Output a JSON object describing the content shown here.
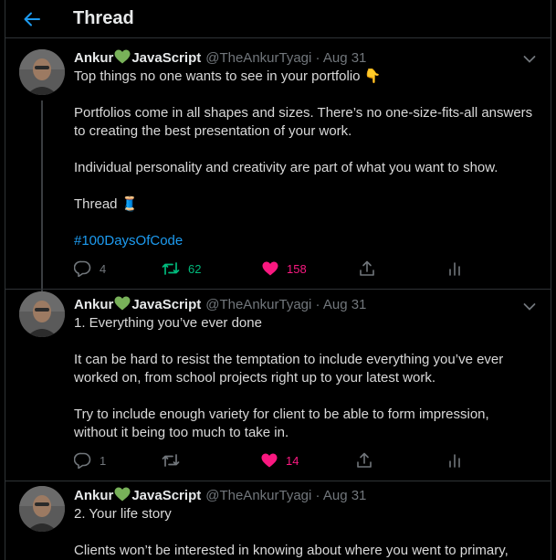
{
  "header": {
    "title": "Thread"
  },
  "tweets": [
    {
      "name_part1": "Ankur",
      "name_part2": "JavaScript",
      "handle": "@TheAnkurTyagi · Aug 31",
      "paragraphs": [
        "Top things no one wants to see in your portfolio 👇",
        "Portfolios come in all shapes and sizes. There’s no one-size-fits-all answers to creating the best presentation of your work.",
        "Individual personality and creativity are part of what you want to show.",
        "Thread 🧵"
      ],
      "hashtag": "#100DaysOfCode",
      "replies": "4",
      "retweets": "62",
      "likes": "158"
    },
    {
      "name_part1": "Ankur",
      "name_part2": "JavaScript",
      "handle": "@TheAnkurTyagi · Aug 31",
      "paragraphs": [
        "1. Everything you’ve ever done",
        "It can be hard to resist the temptation to include everything you’ve ever worked on, from school projects right up to your latest work.",
        "Try to include enough variety for client to be able to form impression, without it being too much to take in."
      ],
      "replies": "1",
      "likes": "14"
    },
    {
      "name_part1": "Ankur",
      "name_part2": "JavaScript",
      "handle": "@TheAnkurTyagi · Aug 31",
      "paragraphs": [
        "2. Your life story",
        "Clients won’t be interested in knowing about where you went to primary,"
      ]
    }
  ],
  "colors": {
    "accent": "#1d9bf0",
    "retweet": "#00ba7c",
    "like": "#f91880",
    "muted": "#71767b",
    "name_heart": "#78b159"
  },
  "icons": [
    "back-arrow-icon",
    "chevron-down-icon",
    "reply-icon",
    "retweet-icon",
    "heart-icon",
    "share-icon",
    "analytics-icon",
    "green-heart-icon"
  ]
}
